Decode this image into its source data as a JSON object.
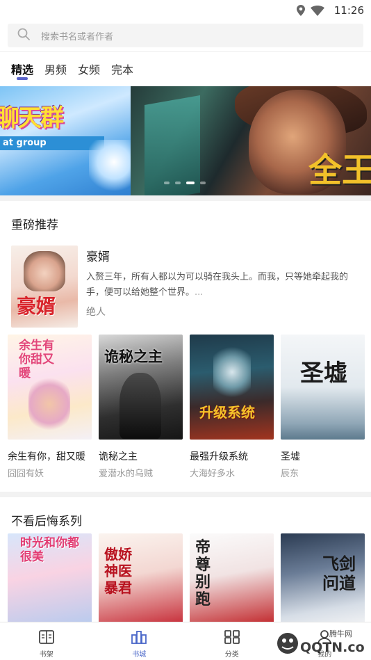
{
  "status_bar": {
    "time": "11:26",
    "icons": [
      "location-icon",
      "wifi-icon"
    ]
  },
  "search": {
    "placeholder": "搜索书名或者作者"
  },
  "tabs": [
    {
      "label": "精选",
      "active": true
    },
    {
      "label": "男频",
      "active": false
    },
    {
      "label": "女频",
      "active": false
    },
    {
      "label": "完本",
      "active": false
    }
  ],
  "banner": {
    "left_title": "聊天群",
    "left_subtitle": "at group",
    "right_word": "全王",
    "slide_count": 4,
    "active_slide": 3
  },
  "section1": {
    "title": "重磅推荐",
    "featured": {
      "name": "豪婿",
      "description": "入赘三年，所有人都以为可以骑在我头上。而我，只等她牵起我的手，便可以给她整个世界。",
      "ellipsis": "...",
      "author": "绝人",
      "cover_text": "豪婿"
    },
    "books": [
      {
        "name": "余生有你，甜又暖",
        "author": "囧囧有妖",
        "cover_text": "余生有你甜又暖"
      },
      {
        "name": "诡秘之主",
        "author": "爱潜水的乌贼",
        "cover_text": "诡秘之主"
      },
      {
        "name": "最强升级系统",
        "author": "大海好多水",
        "cover_text": "升级系统"
      },
      {
        "name": "圣墟",
        "author": "辰东",
        "cover_text": "圣墟"
      }
    ]
  },
  "section2": {
    "title": "不看后悔系列",
    "books": [
      {
        "cover_text": "时光和你都很美"
      },
      {
        "cover_text": "傲娇神医暴君"
      },
      {
        "cover_text": "帝尊别跑"
      },
      {
        "cover_text": "飞剑问道"
      }
    ]
  },
  "bottom_nav": [
    {
      "label": "书架",
      "icon": "bookshelf-icon",
      "active": false
    },
    {
      "label": "书城",
      "icon": "bookstore-icon",
      "active": true
    },
    {
      "label": "分类",
      "icon": "category-icon",
      "active": false
    },
    {
      "label": "我的",
      "icon": "profile-icon",
      "active": false
    }
  ],
  "watermark": {
    "text": "腾牛网",
    "brand": "QQTN.com"
  },
  "colors": {
    "accent": "#5a63c8",
    "active_nav": "#4b68c9"
  }
}
